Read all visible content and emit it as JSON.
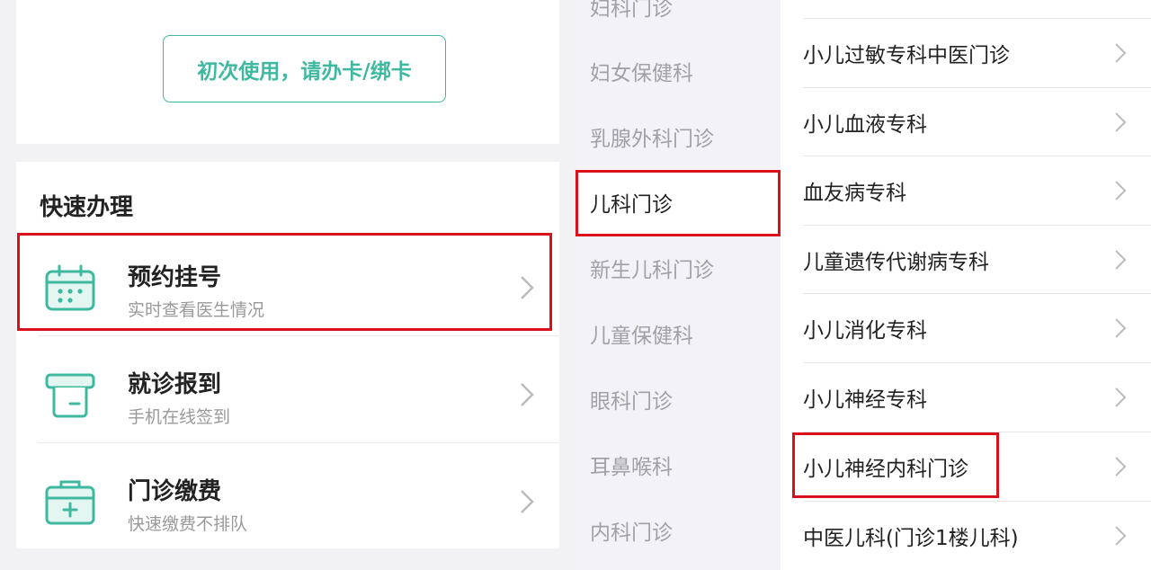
{
  "left": {
    "bind_card_button": "初次使用，请办卡/绑卡",
    "quick_title": "快速办理",
    "quick_items": [
      {
        "title": "预约挂号",
        "subtitle": "实时查看医生情况",
        "icon": "calendar-icon"
      },
      {
        "title": "就诊报到",
        "subtitle": "手机在线签到",
        "icon": "checkin-icon"
      },
      {
        "title": "门诊缴费",
        "subtitle": "快速缴费不排队",
        "icon": "payment-box-icon"
      }
    ]
  },
  "categories": [
    {
      "label": "妇科门诊"
    },
    {
      "label": "妇女保健科"
    },
    {
      "label": "乳腺外科门诊"
    },
    {
      "label": "儿科门诊"
    },
    {
      "label": "新生儿科门诊"
    },
    {
      "label": "儿童保健科"
    },
    {
      "label": "眼科门诊"
    },
    {
      "label": "耳鼻喉科"
    },
    {
      "label": "内科门诊"
    }
  ],
  "active_category": "儿科门诊",
  "departments": [
    {
      "label": "小儿过敏专科中医门诊"
    },
    {
      "label": "小儿血液专科"
    },
    {
      "label": "血友病专科"
    },
    {
      "label": "儿童遗传代谢病专科"
    },
    {
      "label": "小儿消化专科"
    },
    {
      "label": "小儿神经专科"
    },
    {
      "label": "小儿神经内科门诊"
    },
    {
      "label": "中医儿科(门诊1楼儿科)"
    }
  ],
  "colors": {
    "accent": "#3fb8a0",
    "highlight_box": "#d8111c",
    "muted_text": "#a0a0a8"
  }
}
